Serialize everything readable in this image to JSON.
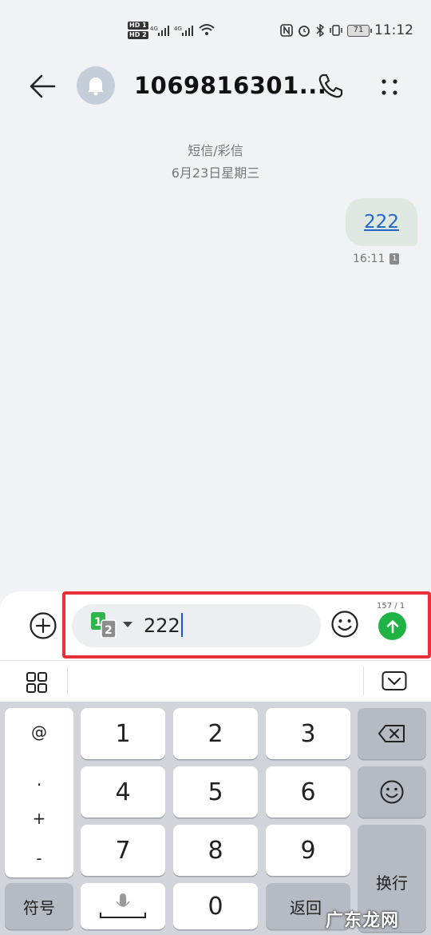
{
  "status_bar": {
    "hd1": "HD 1",
    "hd2": "HD 2",
    "net1": "4G",
    "net2": "4G",
    "battery": "71",
    "time": "11:12"
  },
  "header": {
    "contact": "1069816301..."
  },
  "conversation": {
    "type_label": "短信/彩信",
    "date_label": "6月23日星期三",
    "messages": [
      {
        "text": "222",
        "time": "16:11",
        "sim": "1"
      }
    ]
  },
  "composer": {
    "sim_primary": "1",
    "sim_secondary": "2",
    "input_value": "222",
    "counter": "157 / 1"
  },
  "keyboard": {
    "symbols": [
      "@",
      ".",
      "+",
      "-"
    ],
    "digits": [
      "1",
      "2",
      "3",
      "4",
      "5",
      "6",
      "7",
      "8",
      "9",
      "0"
    ],
    "sym_key": "符号",
    "return_key": "返回",
    "newline_key": "换行"
  },
  "watermark": "广东龙网",
  "colors": {
    "send": "#1fb345",
    "highlight": "#e8303a",
    "link": "#2264c9",
    "bubble": "#dfe7e1"
  }
}
